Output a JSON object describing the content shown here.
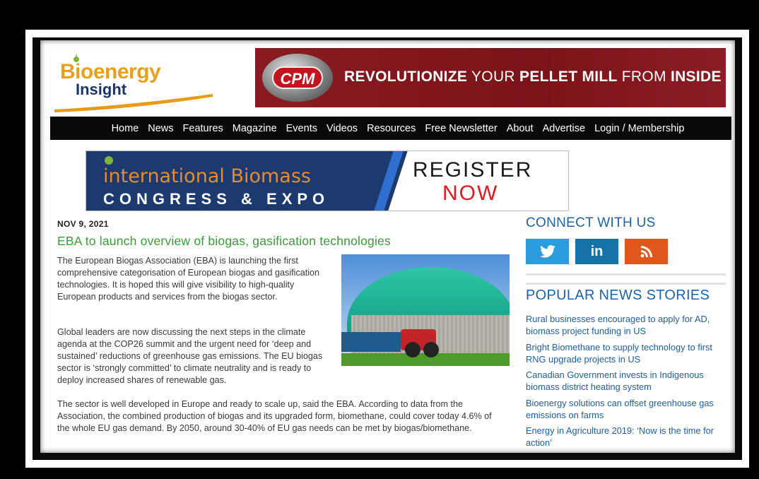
{
  "logo": {
    "line1": "Bioenergy",
    "line2": "Insight"
  },
  "top_banner": {
    "brand": "CPM",
    "tag_bold1": "REVOLUTIONIZE",
    "tag_thin1": " YOUR ",
    "tag_bold2": "PELLET MILL",
    "tag_thin2": " FROM ",
    "tag_bold3": "INSIDE"
  },
  "nav": {
    "items": [
      "Home",
      "News",
      "Features",
      "Magazine",
      "Events",
      "Videos",
      "Resources",
      "Free Newsletter",
      "About",
      "Advertise",
      "Login / Membership"
    ]
  },
  "event_banner": {
    "line1": "international Biomass",
    "line2": "CONGRESS & EXPO",
    "cta1": "REGISTER",
    "cta2": "NOW"
  },
  "article": {
    "date": "NOV 9, 2021",
    "title": "EBA to launch overview of biogas, gasification technologies",
    "p1": "The European Biogas Association (EBA) is launching the first comprehensive categorisation of European biogas and gasification technologies. It is hoped this will give visibility to high-quality European products and services from the biogas sector.",
    "p2": "Global leaders are now discussing the next steps in the climate agenda at the COP26 summit and the urgent need for ‘deep and sustained’ reductions of greenhouse gas emissions. The EU biogas sector is ‘strongly committed’ to climate neutrality and is ready to deploy increased shares of renewable gas.",
    "p3": "The sector is well developed in Europe and ready to scale up, said the EBA. According to data from the Association, the combined production of biogas and its upgraded form, biomethane, could cover today 4.6% of the whole EU gas demand. By 2050, around 30-40% of EU gas needs can be met by biogas/biomethane."
  },
  "sidebar": {
    "connect_title": "CONNECT WITH US",
    "social": {
      "twitter": "🐦",
      "linkedin": "in",
      "rss": "⌘"
    },
    "popular_title": "POPULAR NEWS STORIES",
    "stories": [
      "Rural businesses encouraged to apply for AD, biomass project funding in US",
      "Bright Biomethane to supply technology to first RNG upgrade projects in US",
      "Canadian Government invests in Indigenous biomass district heating system",
      "Bioenergy solutions can offset greenhouse gas emissions on farms",
      "Energy in Agriculture 2019: ‘Now is the time for action’"
    ]
  },
  "colors": {
    "accent_green": "#3c9a3a",
    "link_blue": "#1f5fa0",
    "banner_red": "#7a1419",
    "nav_black": "#0a0a0a"
  }
}
